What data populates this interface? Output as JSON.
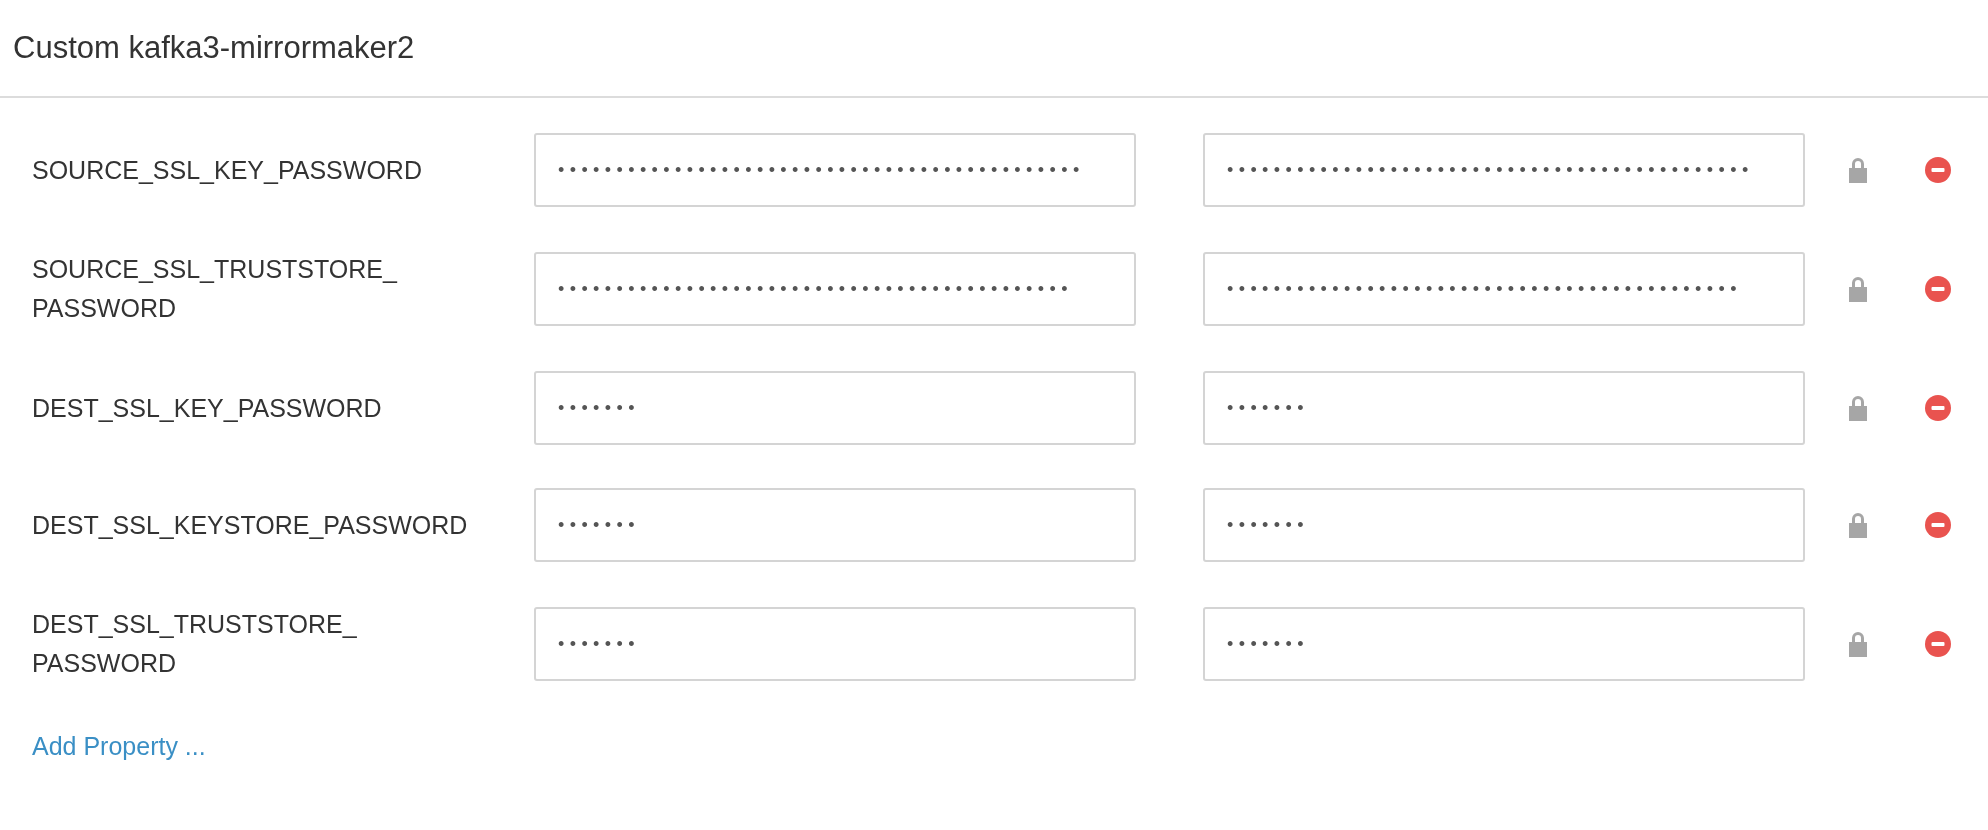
{
  "title": "Custom kafka3-mirrormaker2",
  "properties": [
    {
      "name": "SOURCE_SSL_KEY_PASSWORD",
      "values": [
        "•••••••••••••••••••••••••••••••••••••••••••••",
        "•••••••••••••••••••••••••••••••••••••••••••••"
      ]
    },
    {
      "name": "SOURCE_SSL_TRUSTSTORE_\nPASSWORD",
      "values": [
        "••••••••••••••••••••••••••••••••••••••••••••",
        "••••••••••••••••••••••••••••••••••••••••••••"
      ]
    },
    {
      "name": "DEST_SSL_KEY_PASSWORD",
      "values": [
        "•••••••",
        "•••••••"
      ]
    },
    {
      "name": "DEST_SSL_KEYSTORE_PASSWORD",
      "values": [
        "•••••••",
        "•••••••"
      ]
    },
    {
      "name": "DEST_SSL_TRUSTSTORE_\nPASSWORD",
      "values": [
        "•••••••",
        "•••••••"
      ]
    }
  ],
  "add_link": "Add Property ..."
}
